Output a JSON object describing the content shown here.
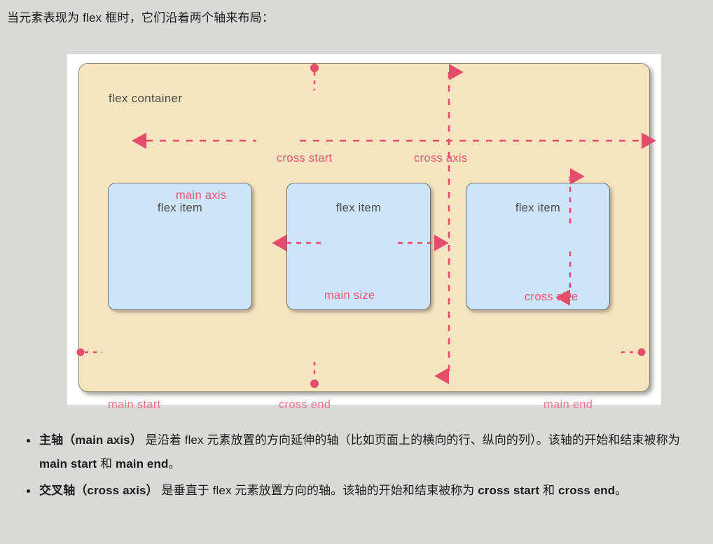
{
  "intro": {
    "text": "当元素表现为 flex 框时，它们沿着两个轴来布局："
  },
  "diagram": {
    "container_label": "flex container",
    "items": [
      {
        "label": "flex item"
      },
      {
        "label": "flex item"
      },
      {
        "label": "flex item"
      }
    ],
    "annotations": {
      "cross_start": "cross start",
      "cross_axis": "cross axis",
      "main_axis": "main axis",
      "main_size": "main size",
      "cross_size": "cross size",
      "main_start": "main start",
      "cross_end": "cross end",
      "main_end": "main end"
    },
    "colors": {
      "container_fill": "#f7e5c0",
      "container_border": "#8b8578",
      "item_fill": "#cce5f9",
      "item_border": "#6f6f6f",
      "annotation": "#ea5570",
      "label_text": "#4c4c4c",
      "panel_background": "#ffffff",
      "page_background": "#d9d9d7"
    }
  },
  "bullets": [
    {
      "term": "主轴",
      "term_en": "（main axis）",
      "part1": " 是沿着 flex 元素放置的方向延伸的轴（比如页面上的横向的行、纵向的列）。该轴的开始和结束被称为 ",
      "strong1": "main start",
      "mid": " 和 ",
      "strong2": "main end",
      "tail": "。"
    },
    {
      "term": "交叉轴",
      "term_en": "（cross axis）",
      "part1": " 是垂直于 flex 元素放置方向的轴。该轴的开始和结束被称为 ",
      "strong1": "cross start",
      "mid": " 和 ",
      "strong2": "cross end",
      "tail": "。"
    }
  ]
}
